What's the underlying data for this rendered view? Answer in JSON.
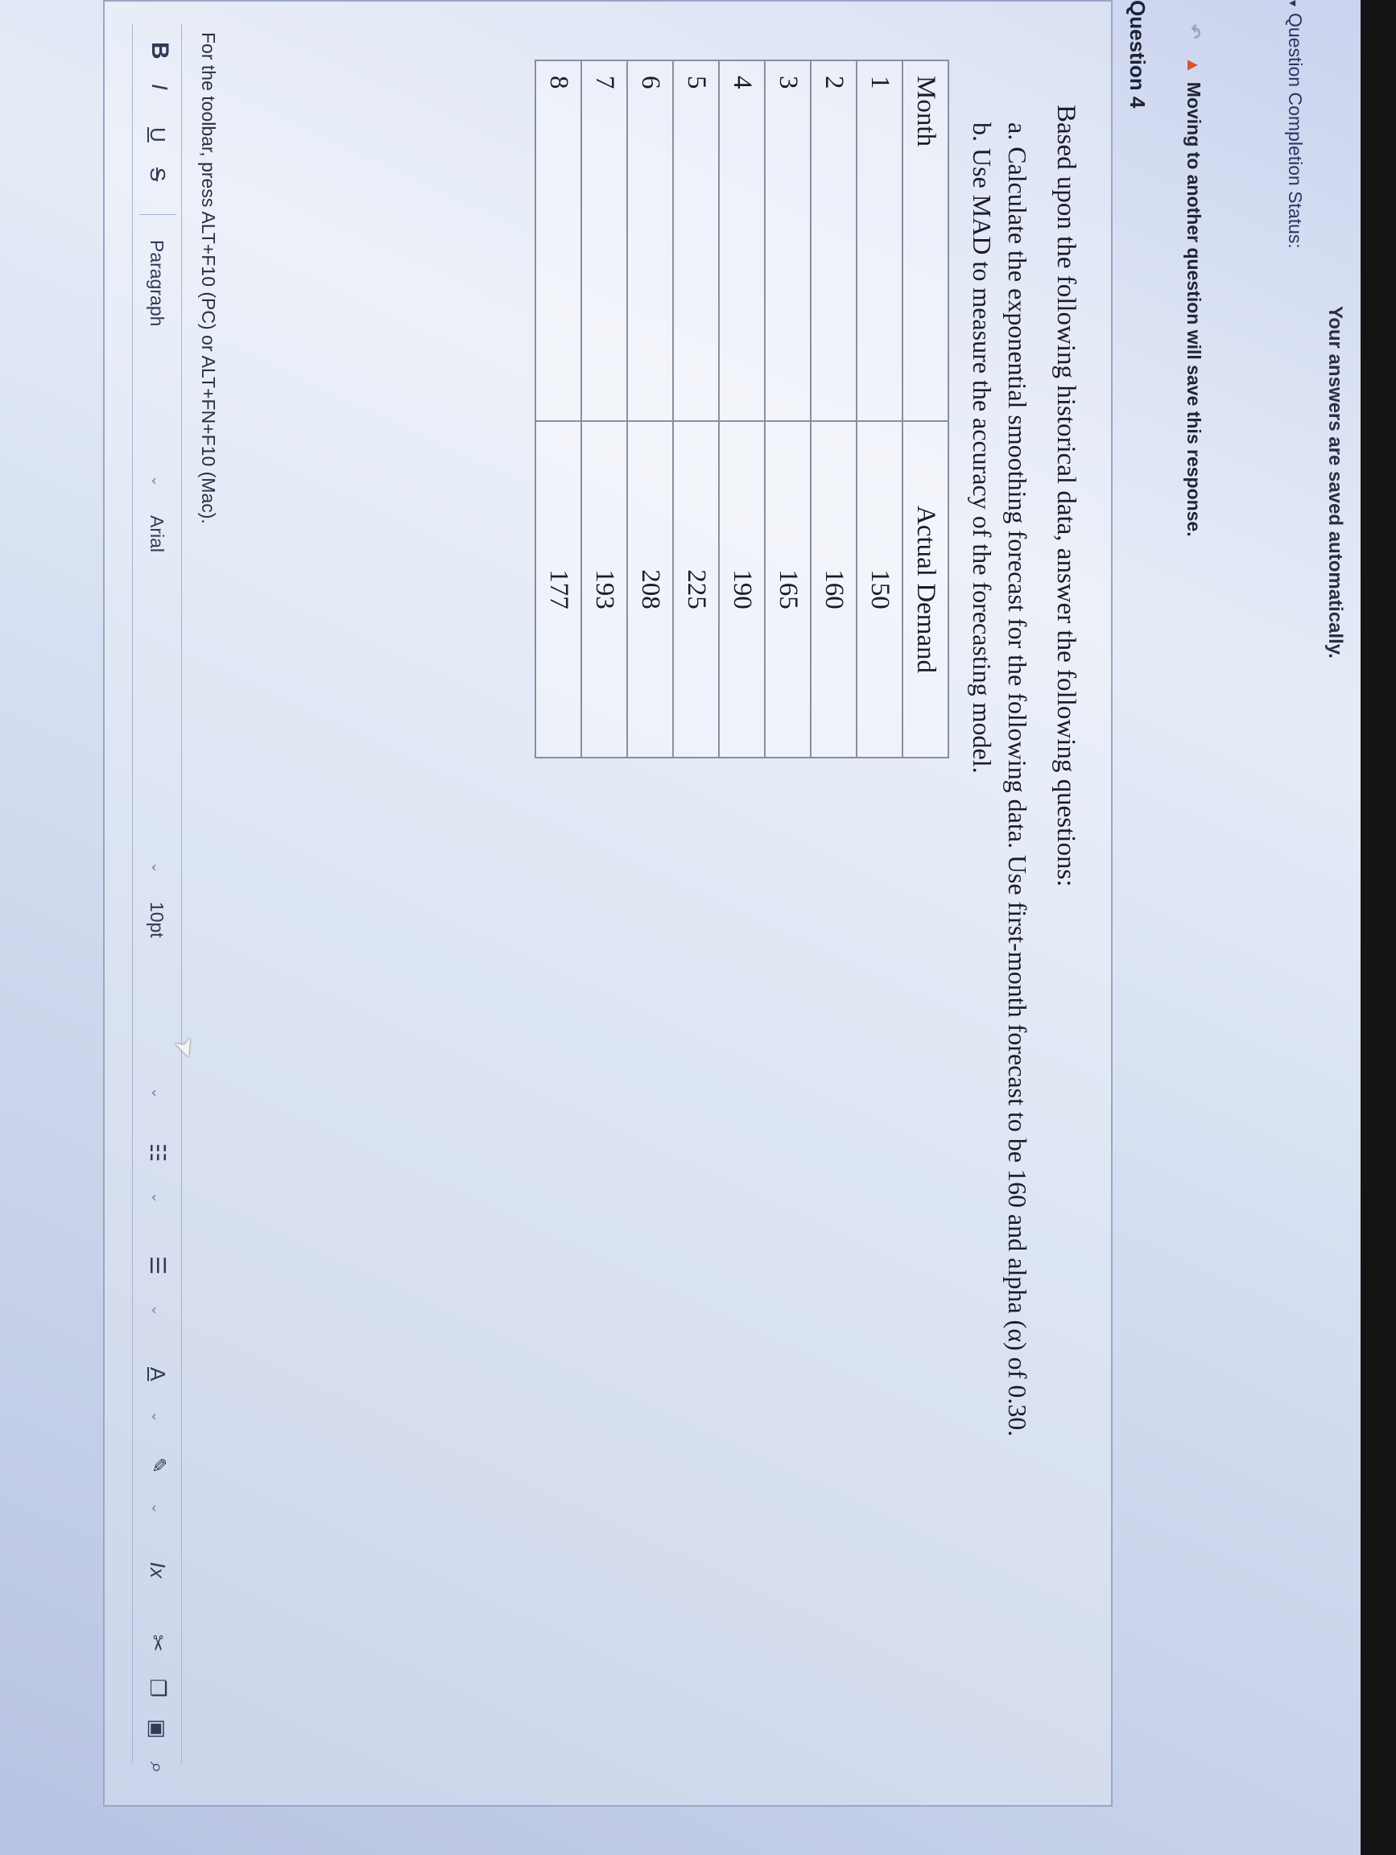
{
  "header": {
    "autosave_note": "Your answers are saved automatically."
  },
  "status": {
    "completion_label": "Question Completion Status:"
  },
  "warning": {
    "text": "Moving to another question will save this response."
  },
  "question": {
    "label": "Question 4",
    "prompt": "Based upon the following historical data, answer the following questions:",
    "item_a": "a. Calculate the exponential smoothing forecast for the following data. Use first-month forecast to be 160 and alpha (α) of 0.30.",
    "item_b": "b. Use MAD to measure the accuracy of the forecasting model."
  },
  "table": {
    "headers": [
      "Month",
      "Actual Demand"
    ],
    "rows": [
      [
        "1",
        "150"
      ],
      [
        "2",
        "160"
      ],
      [
        "3",
        "165"
      ],
      [
        "4",
        "190"
      ],
      [
        "5",
        "225"
      ],
      [
        "6",
        "208"
      ],
      [
        "7",
        "193"
      ],
      [
        "8",
        "177"
      ]
    ]
  },
  "editor": {
    "toolbar_hint": "For the toolbar, press ALT+F10 (PC) or ALT+FN+F10 (Mac).",
    "bold": "B",
    "italic": "I",
    "underline": "U",
    "strike": "S",
    "paragraph": "Paragraph",
    "font": "Arial",
    "size": "10pt",
    "bullets_icon": "bulleted-list-icon",
    "numbered_icon": "numbered-list-icon",
    "text_color_icon": "text-color-icon",
    "highlight_icon": "highlight-icon",
    "clear_format_icon": "clear-formatting-icon",
    "cut_icon": "cut-icon",
    "copy_icon": "copy-icon",
    "paste_icon": "paste-icon",
    "search_icon": "search-icon"
  },
  "colors": {
    "warning_icon": "#d8542a",
    "table_border": "#8a8ea0"
  }
}
